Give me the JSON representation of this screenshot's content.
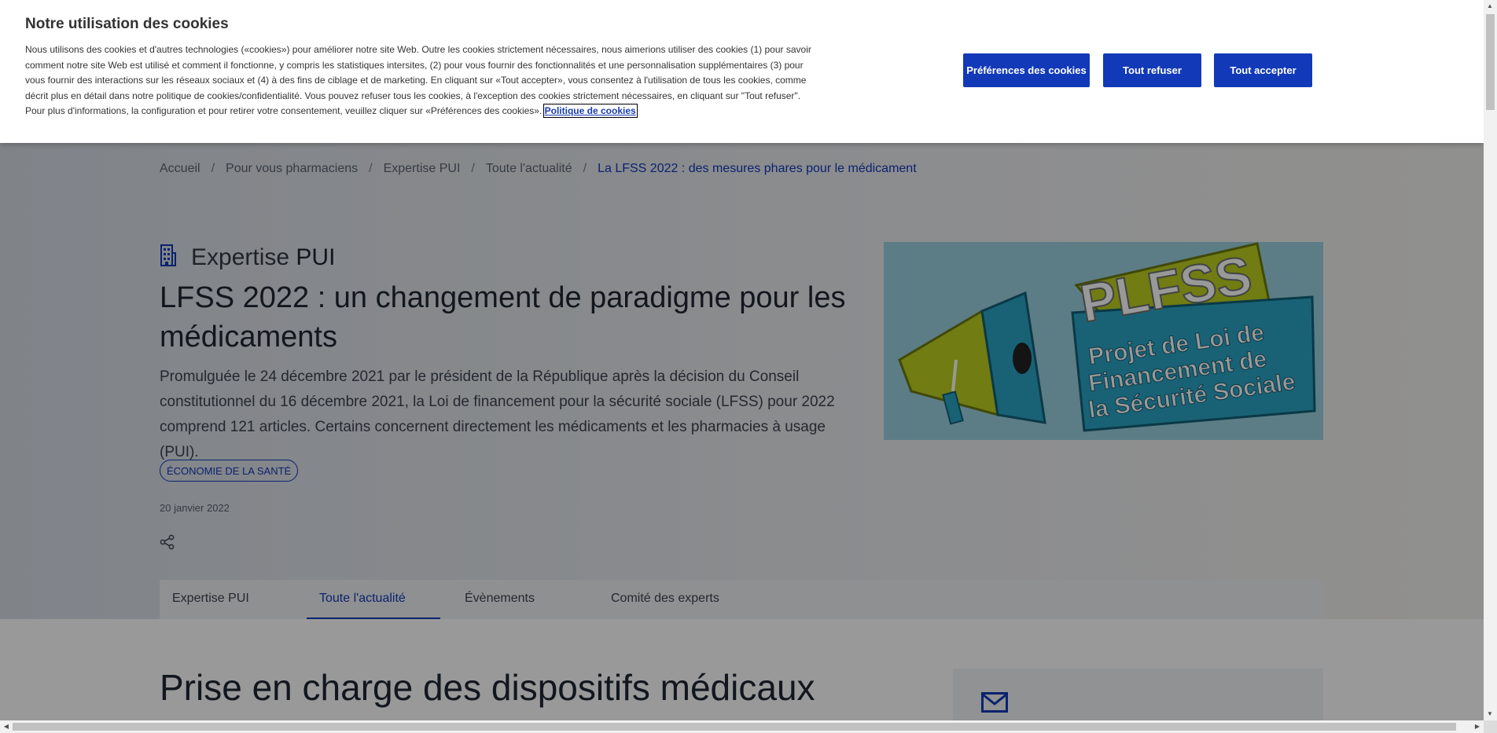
{
  "cookie_banner": {
    "title": "Notre utilisation des cookies",
    "body": "Nous utilisons des cookies et d'autres technologies («cookies») pour améliorer notre site Web. Outre les cookies strictement nécessaires, nous aimerions utiliser des cookies (1) pour savoir comment notre site Web est utilisé et comment il fonctionne, y compris les statistiques intersites, (2) pour vous fournir des fonctionnalités et une personnalisation supplémentaires (3) pour vous fournir des interactions sur les réseaux sociaux et (4) à des fins de ciblage et de marketing. En cliquant sur «Tout accepter», vous consentez à l'utilisation de tous les cookies, comme décrit plus en détail dans notre politique de cookies/confidentialité. Vous pouvez refuser tous les cookies, à l'exception des cookies strictement nécessaires, en cliquant sur \"Tout refuser\". Pour plus d'informations, la configuration et pour retirer votre consentement, veuillez cliquer sur «Préférences des cookies».",
    "policy_link": "Politique de cookies",
    "buttons": {
      "preferences": "Préférences des cookies",
      "reject_all": "Tout refuser",
      "accept_all": "Tout accepter"
    }
  },
  "breadcrumb": {
    "separator": "/",
    "items": [
      "Accueil",
      "Pour vous pharmaciens",
      "Expertise PUI",
      "Toute l'actualité"
    ],
    "current": "La LFSS 2022 : des mesures phares pour le médicament"
  },
  "article": {
    "section_prefix": "Expertise",
    "section_name": "PUI",
    "title": "LFSS 2022 : un changement de paradigme pour les médicaments",
    "lede": "Promulguée le 24 décembre 2021 par le président de la République après la décision du Conseil constitutionnel du 16 décembre 2021, la Loi de financement pour la sécurité sociale (LFSS) pour 2022 comprend 121 articles. Certains concernent directement les médicaments et les pharmacies à usage (PUI).",
    "tag": "ÉCONOMIE DE LA SANTÉ",
    "date": "20 janvier 2022",
    "image": {
      "big_text": "PLFSS",
      "line1": "Projet de Loi de",
      "line2": "Financement de",
      "line3": "la Sécurité Sociale"
    }
  },
  "tabs": [
    {
      "label": "Expertise PUI",
      "active": false
    },
    {
      "label": "Toute l'actualité",
      "active": true
    },
    {
      "label": "Évènements",
      "active": false
    },
    {
      "label": "Comité des experts",
      "active": false
    }
  ],
  "section": {
    "title": "Prise en charge des dispositifs médicaux"
  },
  "icons": {
    "kicker": "building-icon",
    "share": "share-icon",
    "mail": "mail-icon"
  },
  "colors": {
    "brand": "#1239b8",
    "image_bg": "#9ad0df",
    "image_green": "#bccf1e",
    "image_blue": "#2aa3c4"
  }
}
